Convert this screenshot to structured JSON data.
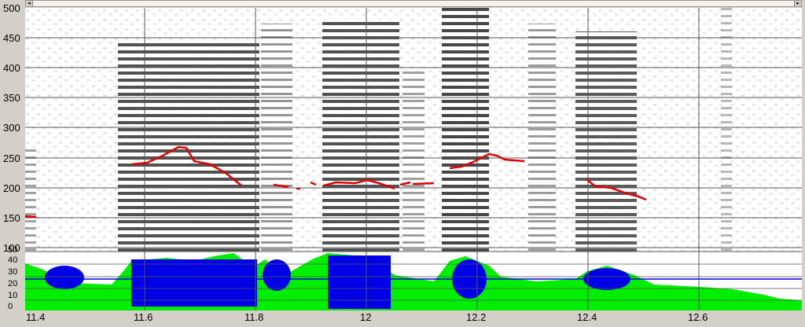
{
  "scrollbar": {
    "left_arrow": "◂",
    "right_arrow": "▸"
  },
  "frequency_axis": {
    "ticks": [
      "500",
      "450",
      "400",
      "350",
      "300",
      "250",
      "200",
      "150",
      "100"
    ]
  },
  "amplitude_axis": {
    "ticks": [
      "50",
      "40",
      "30",
      "20",
      "10",
      "0"
    ]
  },
  "time_axis": {
    "ticks": [
      "11.4",
      "11.6",
      "11.8",
      "12",
      "12.2",
      "12.4",
      "12.6"
    ]
  },
  "colors": {
    "pitch": "#e00000",
    "waveform": "#0000e6",
    "intensity": "#00ee00",
    "grid": "#555555",
    "background": "#d4d0c8"
  }
}
